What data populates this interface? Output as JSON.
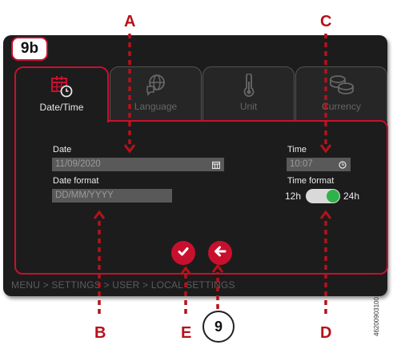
{
  "step_badge": "9b",
  "tabs": [
    {
      "label": "Date/Time",
      "icon": "calendar-clock-icon",
      "active": true
    },
    {
      "label": "Language",
      "icon": "globe-chat-icon",
      "active": false
    },
    {
      "label": "Unit",
      "icon": "thermometer-icon",
      "active": false
    },
    {
      "label": "Currency",
      "icon": "coins-icon",
      "active": false
    }
  ],
  "date": {
    "label": "Date",
    "value": "11/09/2020",
    "icon": "calendar-icon"
  },
  "date_format": {
    "label": "Date format",
    "value": "DD/MM/YYYY"
  },
  "time": {
    "label": "Time",
    "value": "10:07",
    "icon": "clock-icon"
  },
  "time_format": {
    "label": "Time format",
    "left": "12h",
    "right": "24h",
    "selected": "24h"
  },
  "actions": {
    "confirm_icon": "check-icon",
    "back_icon": "back-arrow-icon"
  },
  "breadcrumb": "MENU > SETTINGS > USER > LOCAL SETTINGS",
  "callouts": {
    "a": "A",
    "b": "B",
    "c": "C",
    "d": "D",
    "e": "E",
    "nine": "9"
  },
  "doc_id": "46200903100",
  "colors": {
    "accent": "#c8102e",
    "callout": "#b5121b",
    "toggle_on": "#2fb24a",
    "screen_bg": "#1c1c1c",
    "field_bg": "#595959"
  }
}
